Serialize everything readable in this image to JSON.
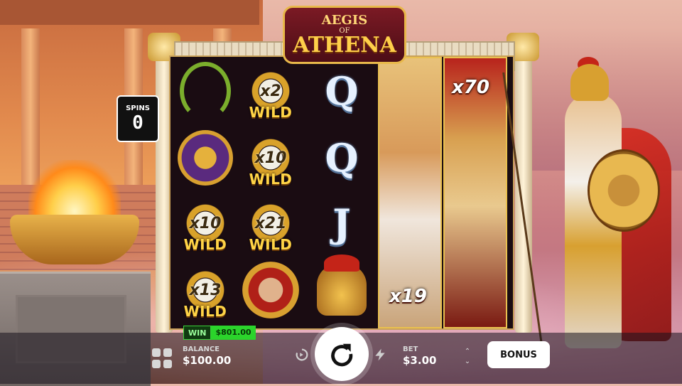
{
  "game": {
    "logo": {
      "line1": "AEGIS",
      "line2": "OF",
      "line3": "ATHENA"
    }
  },
  "spins": {
    "label": "SPINS",
    "value": "0"
  },
  "win": {
    "label": "WIN",
    "value": "$801.00"
  },
  "balance": {
    "label": "BALANCE",
    "value": "$100.00"
  },
  "bet": {
    "label": "BET",
    "value": "$3.00"
  },
  "buttons": {
    "bonus": "BONUS"
  },
  "reels": {
    "col1": [
      "laurel-wreath",
      "medusa-medallion",
      "owl-wild",
      "owl-wild"
    ],
    "col2": [
      "owl-wild",
      "owl-wild",
      "owl-wild",
      "athena-warrior"
    ],
    "col3": [
      "Q",
      "Q",
      "J",
      "spartan-helmet"
    ],
    "col4": "expanded-athena-wild",
    "col5": "expanded-athena-wild"
  },
  "multipliers": {
    "c1r3": "x10",
    "c1r4": "x13",
    "c2r1": "x2",
    "c2r2": "x10",
    "c2r3": "x21",
    "reel4": "x19",
    "reel5": "x70"
  },
  "wild_text": "WILD",
  "card_symbols": {
    "q": "Q",
    "j": "J"
  },
  "icons": [
    "menu-grid-icon",
    "autoplay-icon",
    "spin-icon",
    "turbo-icon",
    "bet-arrows-icon"
  ]
}
